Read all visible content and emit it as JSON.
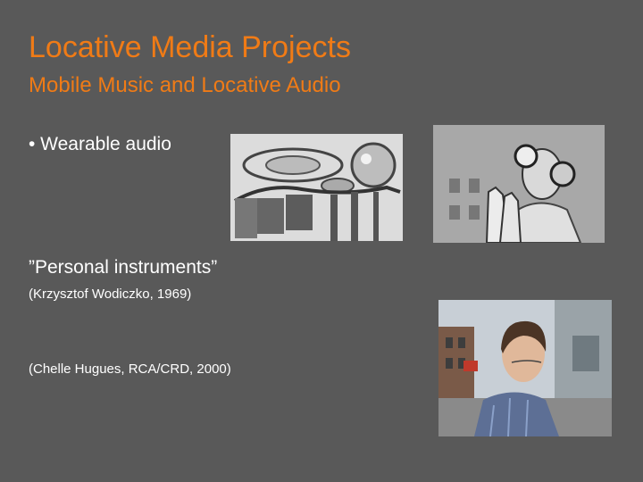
{
  "slide": {
    "title": "Locative Media Projects",
    "subtitle": "Mobile Music and Locative Audio",
    "bullet": "• Wearable audio",
    "instrument_title": "”Personal instruments”",
    "credit_1": "(Krzysztof Wodiczko, 1969)",
    "credit_2": "(Chelle Hugues, RCA/CRD, 2000)"
  },
  "colors": {
    "background": "#595959",
    "heading": "#f07b16",
    "body_text": "#ffffff"
  }
}
